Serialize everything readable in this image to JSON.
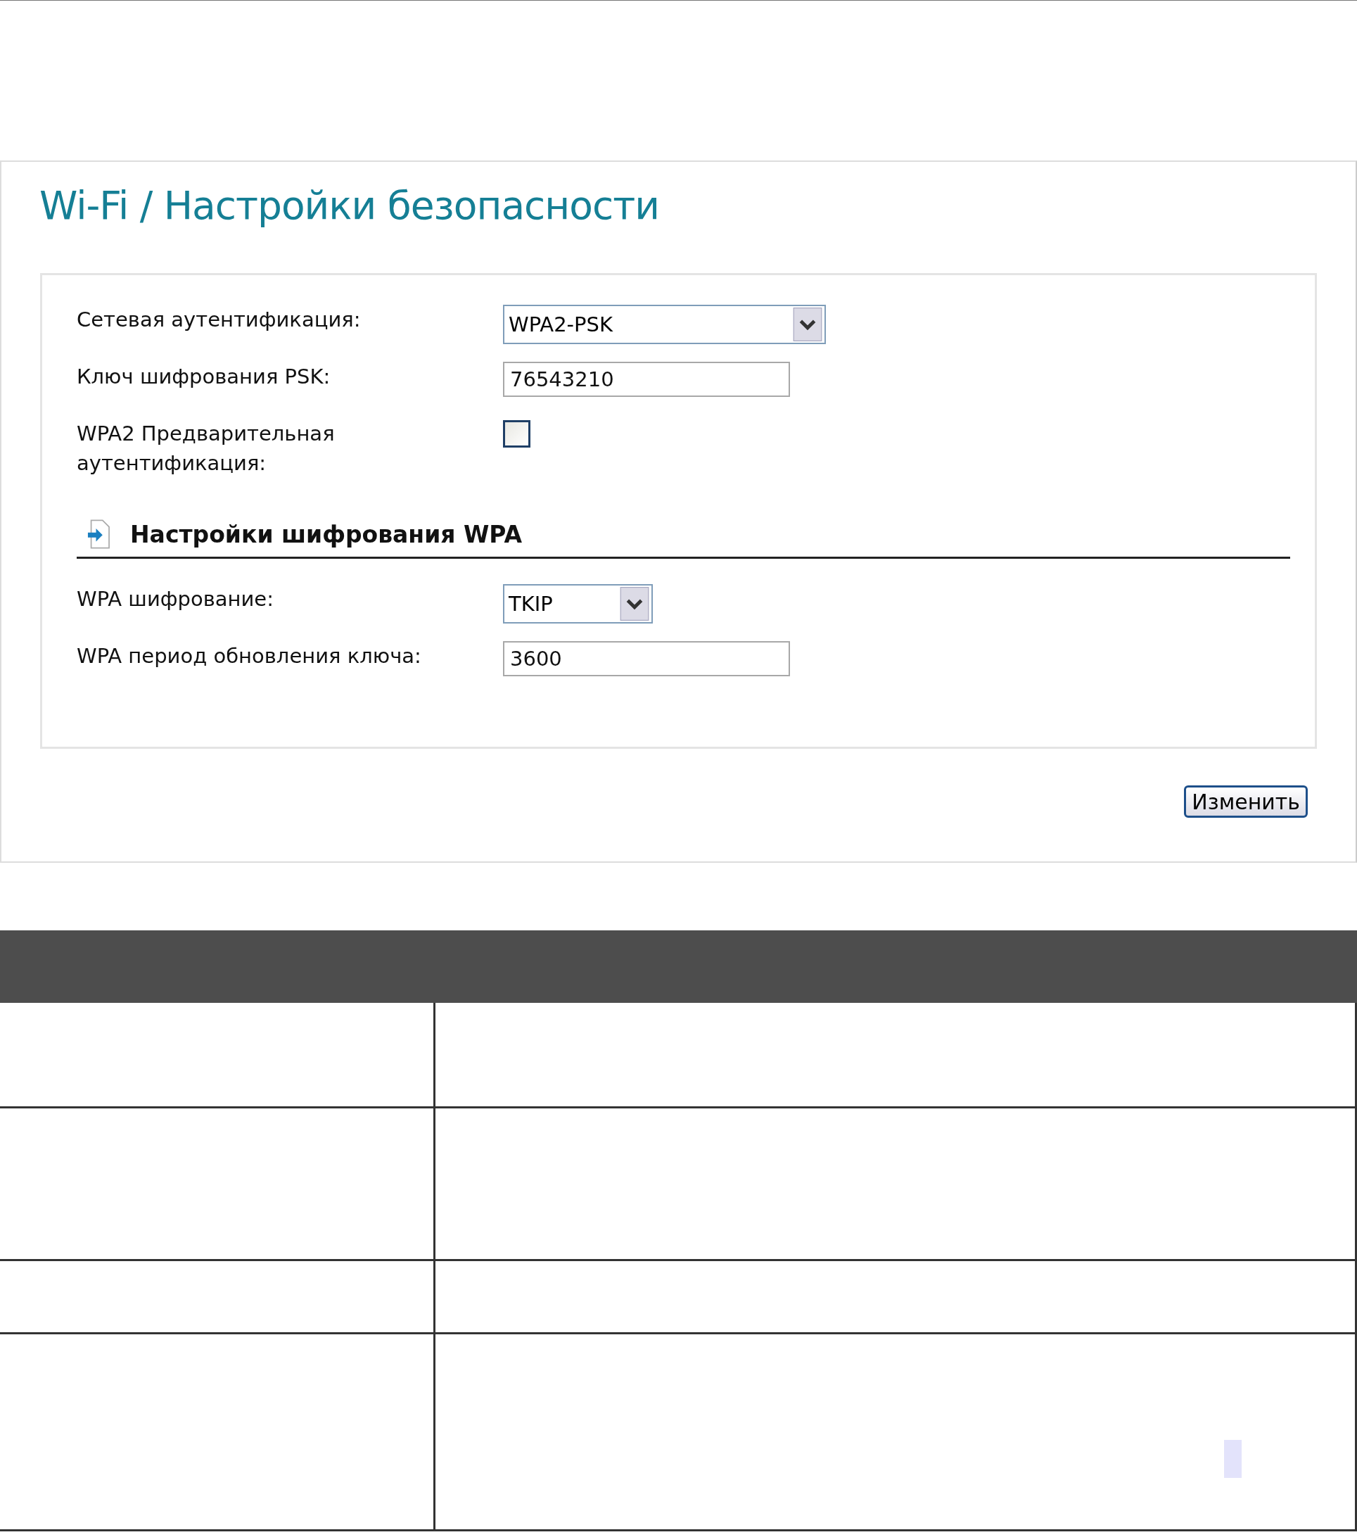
{
  "page_title": "Wi-Fi  / Настройки безопасности",
  "fields": [
    {
      "kind": "select",
      "label": "Сетевая аутентификация:",
      "value": "WPA2-PSK"
    },
    {
      "kind": "text",
      "label": "Ключ шифрования PSK:",
      "value": "76543210"
    },
    {
      "kind": "checkbox",
      "label": "WPA2 Предварительная аутентификация:",
      "checked": false
    }
  ],
  "section": {
    "title": "Настройки шифрования WPA",
    "fields": [
      {
        "kind": "select",
        "label": "WPA шифрование:",
        "value": "TKIP"
      },
      {
        "kind": "text",
        "label": "WPA период обновления ключа:",
        "value": "3600"
      }
    ]
  },
  "button": "Изменить"
}
